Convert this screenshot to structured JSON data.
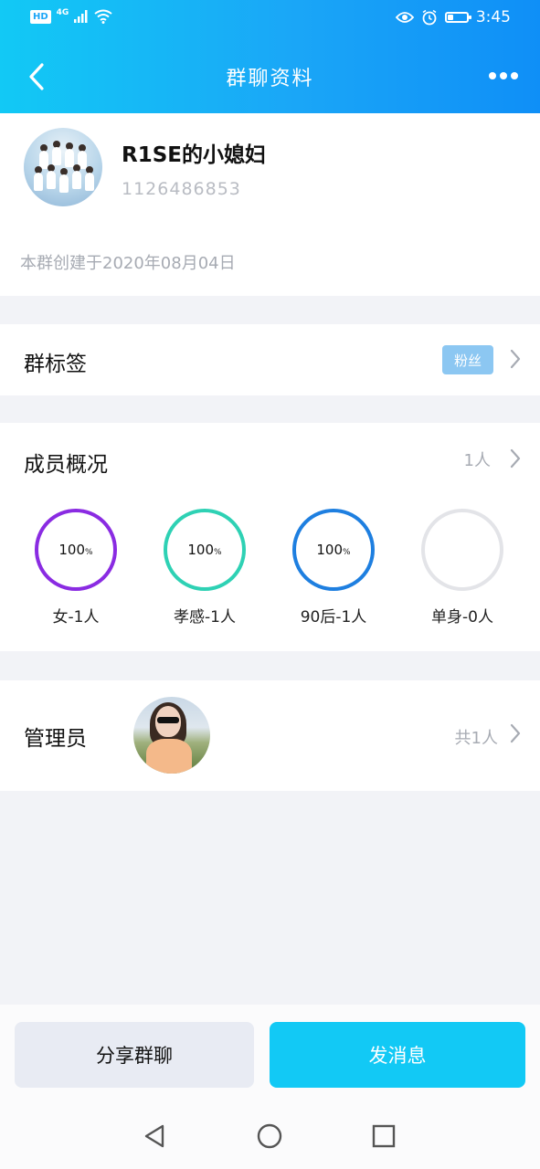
{
  "status_bar": {
    "hd": "HD",
    "network": "4G",
    "time": "3:45",
    "battery_level": 0.3
  },
  "nav": {
    "title": "群聊资料",
    "back_icon": "chevron-left-icon",
    "more_icon": "more-dots-icon"
  },
  "group": {
    "name": "R1SE的小媳妇",
    "id": "1126486853",
    "created": "本群创建于2020年08月04日"
  },
  "tags": {
    "title": "群标签",
    "badge": "粉丝"
  },
  "members": {
    "title": "成员概况",
    "count": "1人",
    "stats": [
      {
        "percent": "100",
        "unit": "%",
        "label": "女-1人",
        "color": "#8a2be2"
      },
      {
        "percent": "100",
        "unit": "%",
        "label": "孝感-1人",
        "color": "#2ed1b4"
      },
      {
        "percent": "100",
        "unit": "%",
        "label": "90后-1人",
        "color": "#1e7fe0"
      },
      {
        "percent": "",
        "unit": "",
        "label": "单身-0人",
        "color": "#e3e4e8"
      }
    ]
  },
  "admins": {
    "title": "管理员",
    "count": "共1人"
  },
  "actions": {
    "share": "分享群聊",
    "send": "发消息"
  },
  "colors": {
    "accent": "#12c9f5",
    "header_end": "#0f8ff7",
    "tag_badge": "#8cc7f2",
    "secondary_text": "#a7abb3"
  }
}
